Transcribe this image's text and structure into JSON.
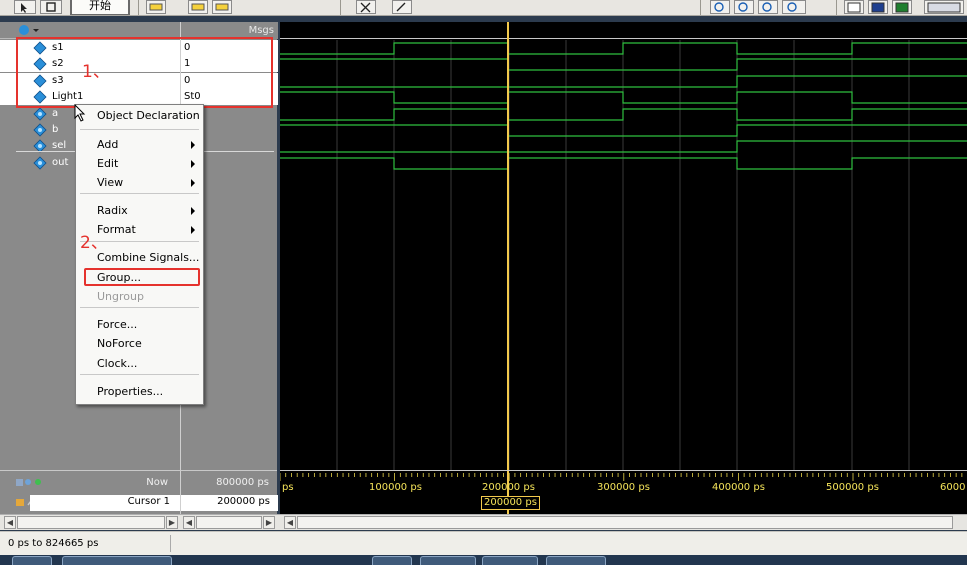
{
  "toolbar": {
    "start_button_label": "开始"
  },
  "signals_header": {
    "values_label": "Msgs"
  },
  "signals": [
    {
      "name": "s1",
      "value": "0",
      "selected": true
    },
    {
      "name": "s2",
      "value": "1",
      "selected": true
    },
    {
      "name": "s3",
      "value": "0",
      "selected": true
    },
    {
      "name": "Light1",
      "value": "St0",
      "selected": true
    },
    {
      "name": "a",
      "value": "",
      "selected": false
    },
    {
      "name": "b",
      "value": "",
      "selected": false
    },
    {
      "name": "sel",
      "value": "",
      "selected": false
    },
    {
      "name": "out",
      "value": "",
      "selected": false
    }
  ],
  "context_menu": {
    "items": [
      {
        "label": "Object Declaration",
        "submenu": false,
        "disabled": false
      },
      {
        "label": "Add",
        "submenu": true,
        "disabled": false
      },
      {
        "label": "Edit",
        "submenu": true,
        "disabled": false
      },
      {
        "label": "View",
        "submenu": true,
        "disabled": false
      },
      {
        "label": "Radix",
        "submenu": true,
        "disabled": false
      },
      {
        "label": "Format",
        "submenu": true,
        "disabled": false
      },
      {
        "label": "Combine Signals...",
        "submenu": false,
        "disabled": false
      },
      {
        "label": "Group...",
        "submenu": false,
        "disabled": false
      },
      {
        "label": "Ungroup",
        "submenu": false,
        "disabled": true
      },
      {
        "label": "Force...",
        "submenu": false,
        "disabled": false
      },
      {
        "label": "NoForce",
        "submenu": false,
        "disabled": false
      },
      {
        "label": "Clock...",
        "submenu": false,
        "disabled": false
      },
      {
        "label": "Properties...",
        "submenu": false,
        "disabled": false
      }
    ]
  },
  "annotations": {
    "step1": "1、",
    "step2": "2、"
  },
  "time_panel": {
    "now_label": "Now",
    "now_value": "800000 ps",
    "cursor_label": "Cursor 1",
    "cursor_value": "200000 ps",
    "cursor_flag": "200000 ps",
    "tick_labels": [
      "ps",
      "100000 ps",
      "200000 ps",
      "300000 ps",
      "400000 ps",
      "500000 ps",
      "6000"
    ]
  },
  "status_bar": {
    "range_text": "0 ps to 824665 ps"
  },
  "waveform": {
    "signal_color": "#2fbf3f",
    "cursor_color": "#f2c94c",
    "grid_color": "#3a3a3a",
    "time_end_ps": 600000,
    "transitions_ps": {
      "s1": [
        0,
        100000,
        200000,
        300000,
        400000,
        500000
      ],
      "s2": [
        0,
        200000,
        400000
      ],
      "s3": [
        0,
        400000
      ],
      "Light1": [
        0,
        100000,
        200000,
        300000,
        400000,
        500000
      ],
      "a": [
        0,
        100000,
        200000,
        300000,
        400000,
        500000
      ],
      "b": [
        0,
        200000,
        400000
      ],
      "sel": [
        0,
        400000
      ],
      "out": [
        0,
        100000,
        200000,
        400000,
        500000
      ]
    }
  }
}
